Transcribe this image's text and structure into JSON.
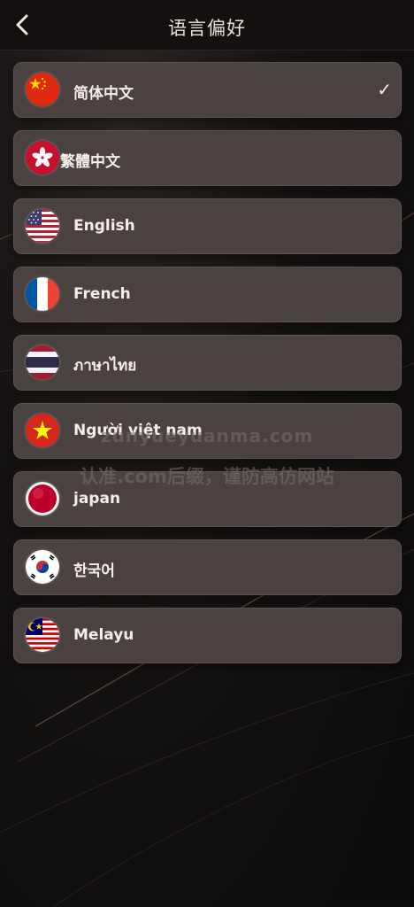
{
  "header": {
    "title": "语言偏好",
    "back_icon": "chevron-left-icon"
  },
  "languages": [
    {
      "label": "简体中文",
      "flag": "china-flag-icon",
      "selected": true
    },
    {
      "label": "繁體中文",
      "flag": "hong-kong-flag-icon",
      "selected": false
    },
    {
      "label": "English",
      "flag": "usa-flag-icon",
      "selected": false
    },
    {
      "label": "French",
      "flag": "france-flag-icon",
      "selected": false
    },
    {
      "label": "ภาษาไทย",
      "flag": "thailand-flag-icon",
      "selected": false
    },
    {
      "label": "Người việt nam",
      "flag": "vietnam-flag-icon",
      "selected": false
    },
    {
      "label": "japan",
      "flag": "japan-flag-icon",
      "selected": false
    },
    {
      "label": "한국어",
      "flag": "korea-flag-icon",
      "selected": false
    },
    {
      "label": "Melayu",
      "flag": "malaysia-flag-icon",
      "selected": false
    }
  ],
  "selected_mark": "✓",
  "watermark": {
    "line1": "zunyueyuanma.com",
    "line2": "认准.com后缀，谨防高仿网站"
  },
  "colors": {
    "row_bg": "#4a4241",
    "header_bg": "#141010",
    "text": "#f3eeea"
  }
}
